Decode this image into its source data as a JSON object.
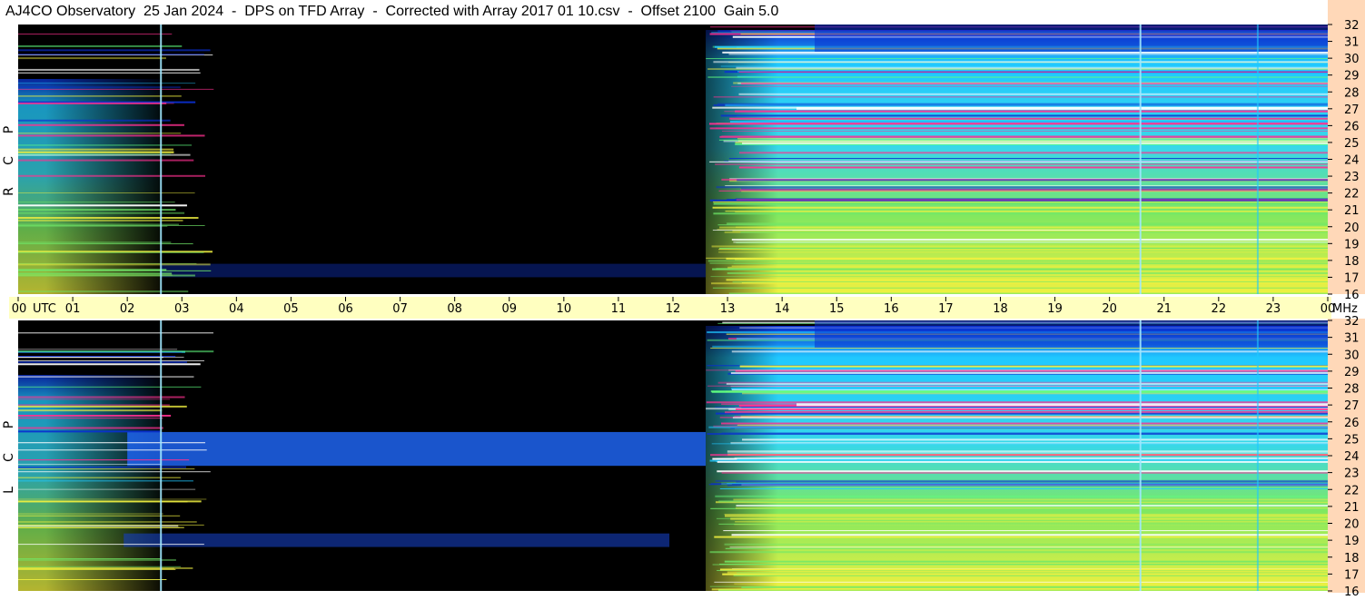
{
  "header": {
    "title": "AJ4CO Observatory  25 Jan 2024  -  DPS on TFD Array  -  Corrected with Array 2017 01 10.csv  -  Offset 2100  Gain 5.0"
  },
  "chart_data": {
    "type": "heatmap",
    "title": "AJ4CO Observatory  25 Jan 2024  -  DPS on TFD Array  -  Corrected with Array 2017 01 10.csv  -  Offset 2100  Gain 5.0",
    "x_axis": {
      "unit_label": "UTC",
      "range": [
        0,
        24
      ],
      "ticks": [
        "00",
        "01",
        "02",
        "03",
        "04",
        "05",
        "06",
        "07",
        "08",
        "09",
        "10",
        "11",
        "12",
        "13",
        "14",
        "15",
        "16",
        "17",
        "18",
        "19",
        "20",
        "21",
        "22",
        "23",
        "00"
      ]
    },
    "y_axis": {
      "unit_label": "MHz",
      "range": [
        16,
        32
      ],
      "ticks": [
        "32",
        "31",
        "30",
        "29",
        "28",
        "27",
        "26",
        "25",
        "24",
        "23",
        "22",
        "21",
        "20",
        "19",
        "18",
        "17",
        "16"
      ]
    },
    "panels": [
      {
        "label_letters": [
          "P",
          "C",
          "R"
        ],
        "night_gap_hours": [
          2.6,
          12.6
        ],
        "low_edge_band": [
          17.0,
          17.8
        ],
        "vertical_lines_hours": [
          2.6,
          20.55,
          22.7
        ]
      },
      {
        "label_letters": [
          "P",
          "C",
          "L"
        ],
        "night_gap_hours": [
          2.6,
          12.6
        ],
        "diffuse_band_mhz": [
          23.4,
          25.4
        ],
        "diffuse_band_hours": [
          2.0,
          12.6
        ],
        "low_band_mhz": [
          18.6,
          19.4
        ],
        "vertical_lines_hours": [
          2.6,
          20.55,
          22.7
        ]
      }
    ],
    "colors": {
      "background": "#000000",
      "weak": "#0a2fd0",
      "medium": "#20c8ff",
      "strong": "#f0f040",
      "very_strong": "#ff3090",
      "saturated": "#ffffff",
      "timebar": "#ffffc0",
      "mhz_scale": "#ffd8b8"
    }
  }
}
